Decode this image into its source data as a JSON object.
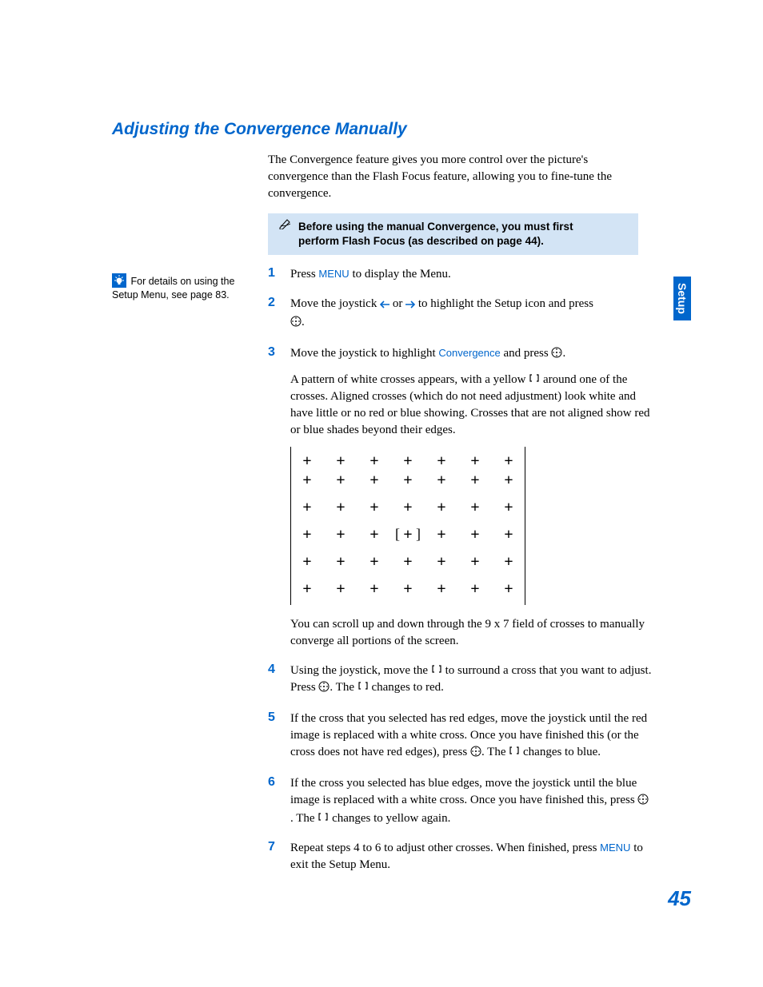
{
  "heading": "Adjusting the Convergence Manually",
  "intro": "The Convergence feature gives you more control over the picture's convergence than the Flash Focus feature, allowing you to fine-tune the convergence.",
  "note": "Before using the manual Convergence, you must first perform Flash Focus (as described on page 44).",
  "sidebar_tip": "For details on using the Setup Menu, see page 83.",
  "side_tab": "Setup",
  "page_number": "45",
  "words": {
    "menu": "MENU",
    "convergence": "Convergence"
  },
  "steps": {
    "s1": {
      "num": "1",
      "a": "Press ",
      "b": " to display the Menu."
    },
    "s2": {
      "num": "2",
      "a": "Move the joystick ",
      "b": " or ",
      "c": " to highlight the Setup icon and press ",
      "d": "."
    },
    "s3": {
      "num": "3",
      "a": "Move the joystick to highlight ",
      "b": " and press ",
      "c": ".",
      "p2a": "A pattern of white crosses appears, with a yellow ",
      "p2b": " around one of the crosses. Aligned crosses (which do not need adjustment) look white and have little or no red or blue showing. Crosses that are not aligned show red or blue shades beyond their edges.",
      "p3": "You can scroll up and down through the 9 x 7 field of crosses to manually converge all portions of the screen."
    },
    "s4": {
      "num": "4",
      "a": "Using the joystick, move the ",
      "b": " to surround a cross that you want to adjust. Press ",
      "c": ". The ",
      "d": " changes to red."
    },
    "s5": {
      "num": "5",
      "a": "If the cross that you selected has red edges, move the joystick until the red image is replaced with a white cross. Once you have finished this (or the cross does not have red edges), press ",
      "b": ". The ",
      "c": " changes to blue."
    },
    "s6": {
      "num": "6",
      "a": "If the cross you selected has blue edges, move the joystick until the blue image is replaced with a white cross. Once you have finished this, press ",
      "b": ". The ",
      "c": " changes to yellow again."
    },
    "s7": {
      "num": "7",
      "a": "Repeat steps 4 to 6 to adjust other crosses. When finished, press ",
      "b": " to exit the Setup Menu."
    }
  }
}
